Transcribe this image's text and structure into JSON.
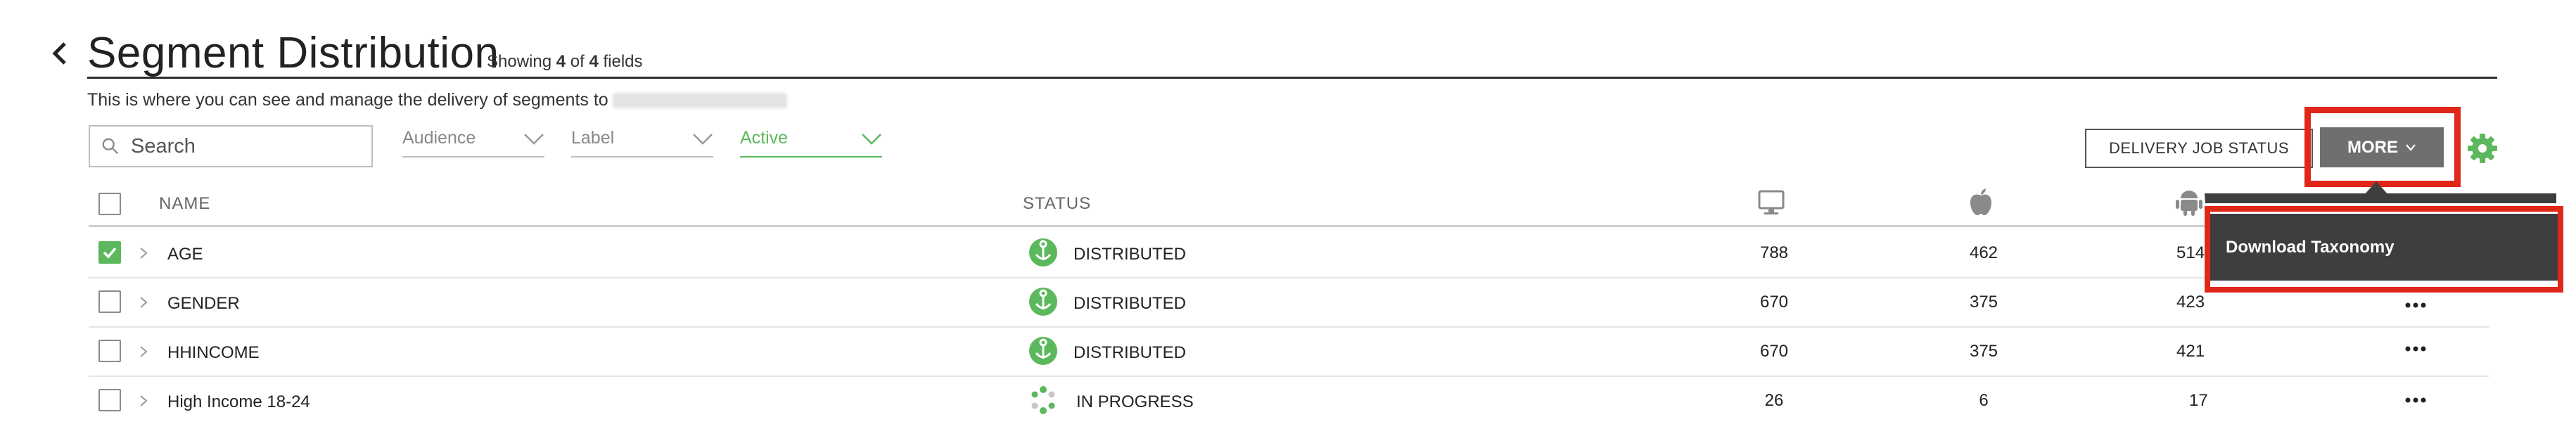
{
  "header": {
    "title": "Segment Distribution",
    "showing": {
      "prefix": "Showing",
      "count": "4",
      "of": "of",
      "total": "4",
      "suffix": "fields"
    },
    "subtitle": "This is where you can see and manage the delivery of segments to"
  },
  "toolbar": {
    "search_placeholder": "Search",
    "filters": [
      {
        "label": "Audience"
      },
      {
        "label": "Label"
      },
      {
        "label": "Active"
      }
    ],
    "delivery_job_status_label": "DELIVERY JOB STATUS",
    "more_label": "MORE"
  },
  "table": {
    "columns": {
      "name": "NAME",
      "status": "STATUS"
    },
    "column_icons": [
      "desktop-icon",
      "apple-icon",
      "android-icon"
    ],
    "rows": [
      {
        "name": "AGE",
        "checked": true,
        "status": "DISTRIBUTED",
        "status_icon": "distributed-icon",
        "desktop": "788",
        "ios": "462",
        "android": "514"
      },
      {
        "name": "GENDER",
        "checked": false,
        "status": "DISTRIBUTED",
        "status_icon": "distributed-icon",
        "desktop": "670",
        "ios": "375",
        "android": "423"
      },
      {
        "name": "HHINCOME",
        "checked": false,
        "status": "DISTRIBUTED",
        "status_icon": "distributed-icon",
        "desktop": "670",
        "ios": "375",
        "android": "421"
      },
      {
        "name": "High Income 18-24",
        "checked": false,
        "status": "IN PROGRESS",
        "status_icon": "in-progress-icon",
        "desktop": "26",
        "ios": "6",
        "android": "17"
      }
    ]
  },
  "more_menu": {
    "items": [
      {
        "label": "Download Taxonomy"
      }
    ]
  },
  "colors": {
    "accent_green": "#5cb85c",
    "highlight_red": "#e0271a",
    "menu_dark": "#3e3e3e",
    "more_button_gray": "#6f6f6f"
  }
}
